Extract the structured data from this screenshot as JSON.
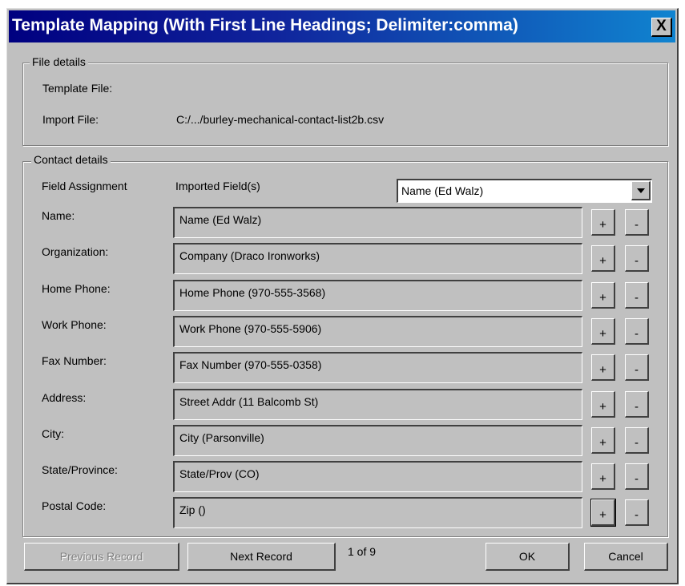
{
  "window": {
    "title": "Template Mapping (With First Line Headings; Delimiter:comma)",
    "close_label": "X"
  },
  "file_details": {
    "legend": "File details",
    "template_file_label": "Template File:",
    "template_file_value": "",
    "import_file_label": "Import File:",
    "import_file_value": "C:/.../burley-mechanical-contact-list2b.csv"
  },
  "contact_details": {
    "legend": "Contact details",
    "field_assignment_header": "Field Assignment",
    "imported_fields_header": "Imported Field(s)",
    "field_select": {
      "selected": "Name (Ed Walz)"
    },
    "rows": [
      {
        "label": "Name:",
        "value": "Name (Ed Walz)"
      },
      {
        "label": "Organization:",
        "value": "Company (Draco Ironworks)"
      },
      {
        "label": "Home Phone:",
        "value": "Home Phone (970-555-3568)"
      },
      {
        "label": "Work Phone:",
        "value": "Work Phone (970-555-5906)"
      },
      {
        "label": "Fax Number:",
        "value": "Fax Number (970-555-0358)"
      },
      {
        "label": "Address:",
        "value": "Street Addr (11 Balcomb St)"
      },
      {
        "label": "City:",
        "value": "City (Parsonville)"
      },
      {
        "label": "State/Province:",
        "value": "State/Prov (CO)"
      },
      {
        "label": "Postal Code:",
        "value": "Zip ()"
      }
    ],
    "add_label": "+",
    "remove_label": "-"
  },
  "footer": {
    "previous_label": "Previous Record",
    "next_label": "Next Record",
    "record_counter": "1 of 9",
    "ok_label": "OK",
    "cancel_label": "Cancel"
  }
}
